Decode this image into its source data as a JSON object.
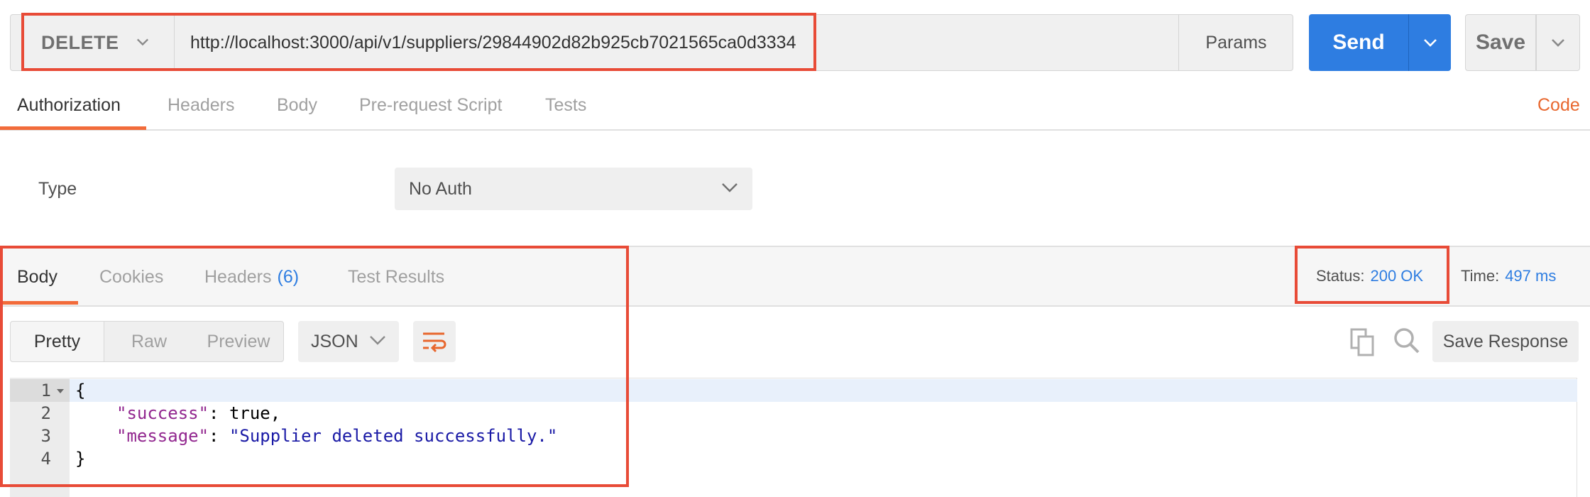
{
  "request": {
    "method": "DELETE",
    "url": "http://localhost:3000/api/v1/suppliers/29844902d82b925cb7021565ca0d3334",
    "params_label": "Params",
    "send_label": "Send",
    "save_label": "Save"
  },
  "request_tabs": [
    "Authorization",
    "Headers",
    "Body",
    "Pre-request Script",
    "Tests"
  ],
  "code_link": "Code",
  "auth": {
    "type_label": "Type",
    "selected": "No Auth"
  },
  "response": {
    "tabs": {
      "body": "Body",
      "cookies": "Cookies",
      "headers": "Headers",
      "headers_count": "(6)",
      "test_results": "Test Results"
    },
    "status_label": "Status:",
    "status_value": "200 OK",
    "time_label": "Time:",
    "time_value": "497 ms",
    "view_modes": [
      "Pretty",
      "Raw",
      "Preview"
    ],
    "format": "JSON",
    "save_response_label": "Save Response",
    "code_lines": {
      "l1": "{",
      "l2_key": "\"success\"",
      "l2_sep": ": ",
      "l2_val": "true,",
      "l3_key": "\"message\"",
      "l3_sep": ": ",
      "l3_val": "\"Supplier deleted successfully.\"",
      "l4": "}"
    },
    "line_numbers": [
      "1",
      "2",
      "3",
      "4"
    ]
  },
  "colors": {
    "accent": "#2e7de1",
    "tab_underline": "#f26b3a",
    "highlight": "#e84b37"
  }
}
